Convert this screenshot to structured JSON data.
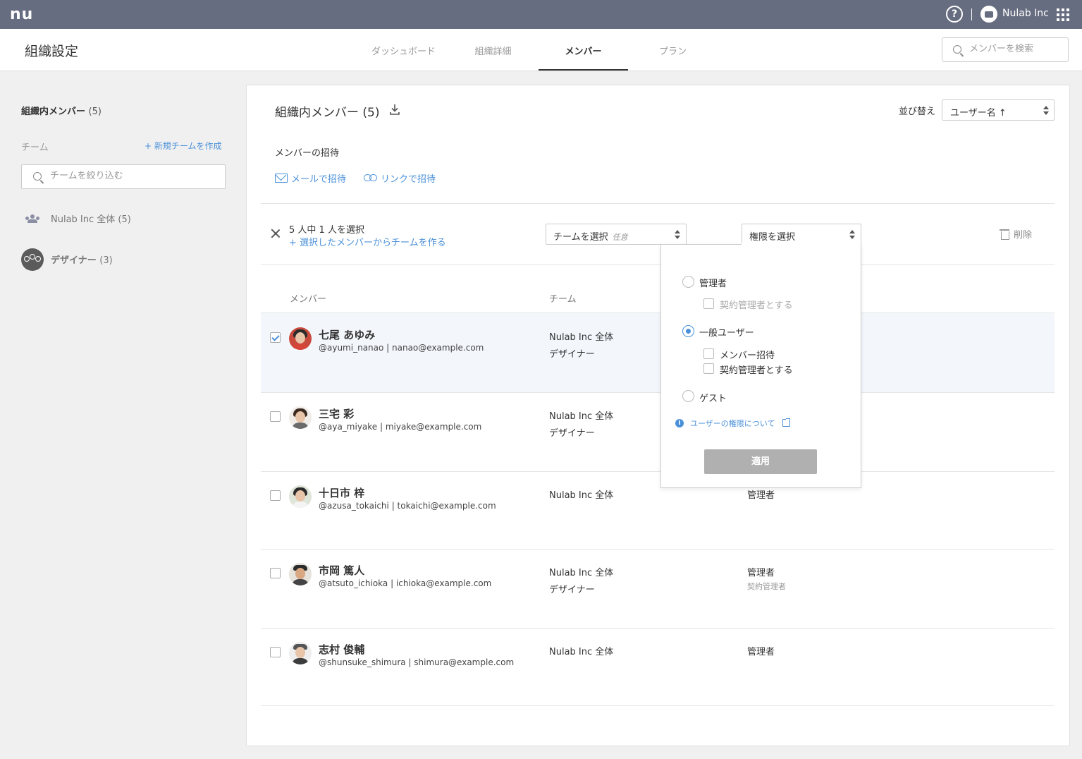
{
  "topbar": {
    "logo": "nu",
    "help_icon": "?",
    "org_name": "Nulab Inc",
    "icons": [
      "help-icon",
      "org-avatar-icon",
      "apps-grid-icon"
    ]
  },
  "header": {
    "title": "組織設定",
    "tabs": [
      {
        "label": "ダッシュボード",
        "active": false
      },
      {
        "label": "組織詳細",
        "active": false
      },
      {
        "label": "メンバー",
        "active": true
      },
      {
        "label": "プラン",
        "active": false
      }
    ],
    "search_placeholder": "メンバーを検索"
  },
  "sidebar": {
    "heading": "組織内メンバー",
    "heading_count": "(5)",
    "team_label": "チーム",
    "new_team": "+ 新規チームを作成",
    "filter_placeholder": "チームを絞り込む",
    "teams": [
      {
        "name": "Nulab Inc 全体",
        "count": "(5)",
        "icon": "people-icon"
      },
      {
        "name": "デザイナー",
        "count": "(3)",
        "icon": "team-avatar-icon"
      }
    ]
  },
  "main": {
    "title": "組織内メンバー (5)",
    "sort_label": "並び替え",
    "sort_value": "ユーザー名 ↑",
    "invite_heading": "メンバーの招待",
    "invite_mail": "メールで招待",
    "invite_link": "リンクで招待",
    "selection": {
      "count_text": "5 人中 1 人を選択",
      "create_team": "+ 選択したメンバーからチームを作る",
      "team_select": "チームを選択",
      "team_select_optional": "任意",
      "perm_select": "権限を選択",
      "delete": "削除"
    },
    "columns": {
      "member": "メンバー",
      "team": "チーム"
    },
    "members": [
      {
        "name": "七尾 あゆみ",
        "sub": "@ayumi_nanao | nanao@example.com",
        "teams": [
          "Nulab Inc 全体",
          "デザイナー"
        ],
        "role": "",
        "role_sub": "",
        "checked": true
      },
      {
        "name": "三宅 彩",
        "sub": "@aya_miyake | miyake@example.com",
        "teams": [
          "Nulab Inc 全体",
          "デザイナー"
        ],
        "role": "",
        "role_sub": "",
        "checked": false
      },
      {
        "name": "十日市 梓",
        "sub": "@azusa_tokaichi | tokaichi@example.com",
        "teams": [
          "Nulab Inc 全体"
        ],
        "role": "管理者",
        "role_sub": "",
        "checked": false
      },
      {
        "name": "市岡 篤人",
        "sub": "@atsuto_ichioka | ichioka@example.com",
        "teams": [
          "Nulab Inc 全体",
          "デザイナー"
        ],
        "role": "管理者",
        "role_sub": "契約管理者",
        "checked": false
      },
      {
        "name": "志村 俊輔",
        "sub": "@shunsuke_shimura | shimura@example.com",
        "teams": [
          "Nulab Inc 全体"
        ],
        "role": "管理者",
        "role_sub": "",
        "checked": false
      }
    ]
  },
  "permission_dropdown": {
    "admin": "管理者",
    "admin_contract": "契約管理者とする",
    "general": "一般ユーザー",
    "general_invite": "メンバー招待",
    "general_contract": "契約管理者とする",
    "guest": "ゲスト",
    "help_link": "ユーザーの権限について",
    "apply": "適用",
    "selected": "一般ユーザー"
  },
  "colors": {
    "topbar": "#676d80",
    "accent": "#4a90d9",
    "selected_row": "#f3f6fb",
    "apply_disabled": "#b0b0b0"
  }
}
